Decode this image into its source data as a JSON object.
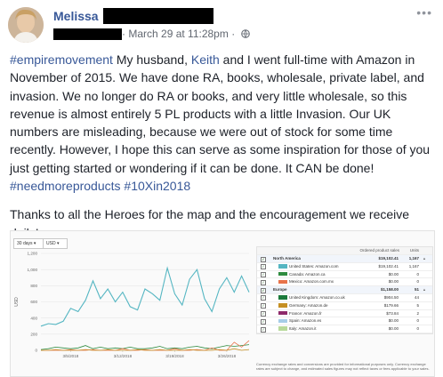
{
  "post": {
    "author": "Melissa",
    "timestamp": "March 29 at 11:28pm",
    "more_glyph": "•••",
    "paragraph1": [
      {
        "text": "#empiremovement",
        "link": true
      },
      {
        "text": " My husband, ",
        "link": false
      },
      {
        "text": "Keith",
        "link": true
      },
      {
        "text": " and I went full-time with Amazon in November of 2015. We have done RA, books, wholesale, private label, and invasion. We no longer do RA or books, and very little wholesale, so this revenue is almost entirely 5 PL products with a little Invasion. Our UK numbers are misleading, because we were out of stock for some time recently. However, I hope this can serve as some inspiration for those of you just getting started or wondering if it can be done. It CAN be done! ",
        "link": false
      },
      {
        "text": "#needmoreproducts",
        "link": true
      },
      {
        "text": " ",
        "link": false
      },
      {
        "text": "#10Xin2018",
        "link": true
      }
    ],
    "paragraph2": "Thanks to all the Heroes for the map and the encouragement we receive daily!",
    "colors": {
      "link": "#385898",
      "text": "#1d2129",
      "meta": "#616770"
    },
    "icons": [
      "avatar",
      "globe-icon",
      "more-options-icon"
    ]
  },
  "screenshot": {
    "controls": {
      "range": "30 days",
      "currency": "USD"
    },
    "chart_data": {
      "type": "line",
      "ylabel": "USD",
      "ylim": [
        0,
        1200
      ],
      "yticks": [
        "1,200",
        "1,000",
        "800",
        "600",
        "400",
        "200",
        "0"
      ],
      "xticks": [
        "3/5/2018",
        "3/12/2018",
        "3/19/2018",
        "3/26/2018"
      ],
      "series": [
        {
          "color": "#55b6c2",
          "values": [
            300,
            330,
            320,
            360,
            520,
            480,
            620,
            860,
            640,
            760,
            600,
            720,
            540,
            500,
            760,
            700,
            620,
            1020,
            700,
            560,
            880,
            1000,
            640,
            480,
            760,
            900,
            720,
            920,
            720
          ]
        },
        {
          "color": "#2e8b3f",
          "values": [
            10,
            20,
            40,
            30,
            20,
            30,
            60,
            20,
            40,
            20,
            30,
            20,
            40,
            20,
            20,
            30,
            50,
            20,
            30,
            20,
            40,
            50,
            30,
            20,
            40,
            60,
            50,
            60,
            70
          ]
        },
        {
          "color": "#e8734a",
          "values": [
            0,
            0,
            0,
            0,
            10,
            0,
            0,
            10,
            0,
            0,
            0,
            20,
            0,
            0,
            10,
            0,
            0,
            0,
            20,
            0,
            0,
            10,
            0,
            30,
            0,
            0,
            100,
            40,
            120
          ]
        },
        {
          "color": "#c58f23",
          "values": [
            0,
            0,
            10,
            0,
            0,
            0,
            10,
            0,
            0,
            10,
            0,
            0,
            0,
            10,
            0,
            0,
            10,
            0,
            0,
            0,
            10,
            0,
            0,
            0,
            10,
            0,
            20,
            0,
            10
          ]
        }
      ]
    },
    "table": {
      "headers": {
        "sales": "Ordered product sales",
        "units": "Units"
      },
      "rows": [
        {
          "type": "group",
          "label": "North America",
          "sales": "$19,102.41",
          "units": "1,167",
          "arrow": "▲"
        },
        {
          "type": "item",
          "swatch": "#55b6c2",
          "label": "United States: Amazon.com",
          "sales": "$19,102.41",
          "units": "1,167"
        },
        {
          "type": "item",
          "swatch": "#2e8b3f",
          "label": "Canada: Amazon.ca",
          "sales": "$0.00",
          "units": "0"
        },
        {
          "type": "item",
          "swatch": "#e8734a",
          "label": "Mexico: Amazon.com.mx",
          "sales": "$0.00",
          "units": "0"
        },
        {
          "type": "group",
          "label": "Europe",
          "sales": "$1,158.00",
          "units": "51",
          "arrow": "▲"
        },
        {
          "type": "item",
          "swatch": "#1a7a3c",
          "label": "United Kingdom: Amazon.co.uk",
          "sales": "$904.50",
          "units": "44"
        },
        {
          "type": "item",
          "swatch": "#c58f23",
          "label": "Germany: Amazon.de",
          "sales": "$179.66",
          "units": "5"
        },
        {
          "type": "item",
          "swatch": "#8e2a6a",
          "label": "France: Amazon.fr",
          "sales": "$73.84",
          "units": "2"
        },
        {
          "type": "item",
          "swatch": "#a6cde8",
          "label": "Spain: Amazon.es",
          "sales": "$0.00",
          "units": "0"
        },
        {
          "type": "item",
          "swatch": "#b8d99a",
          "label": "Italy: Amazon.it",
          "sales": "$0.00",
          "units": "0"
        }
      ],
      "note": "Currency exchange rates and conversions are provided for informational purposes only. Currency exchange rates are subject to change, and estimated sales figures may not reflect taxes or fees applicable to your sales."
    }
  }
}
